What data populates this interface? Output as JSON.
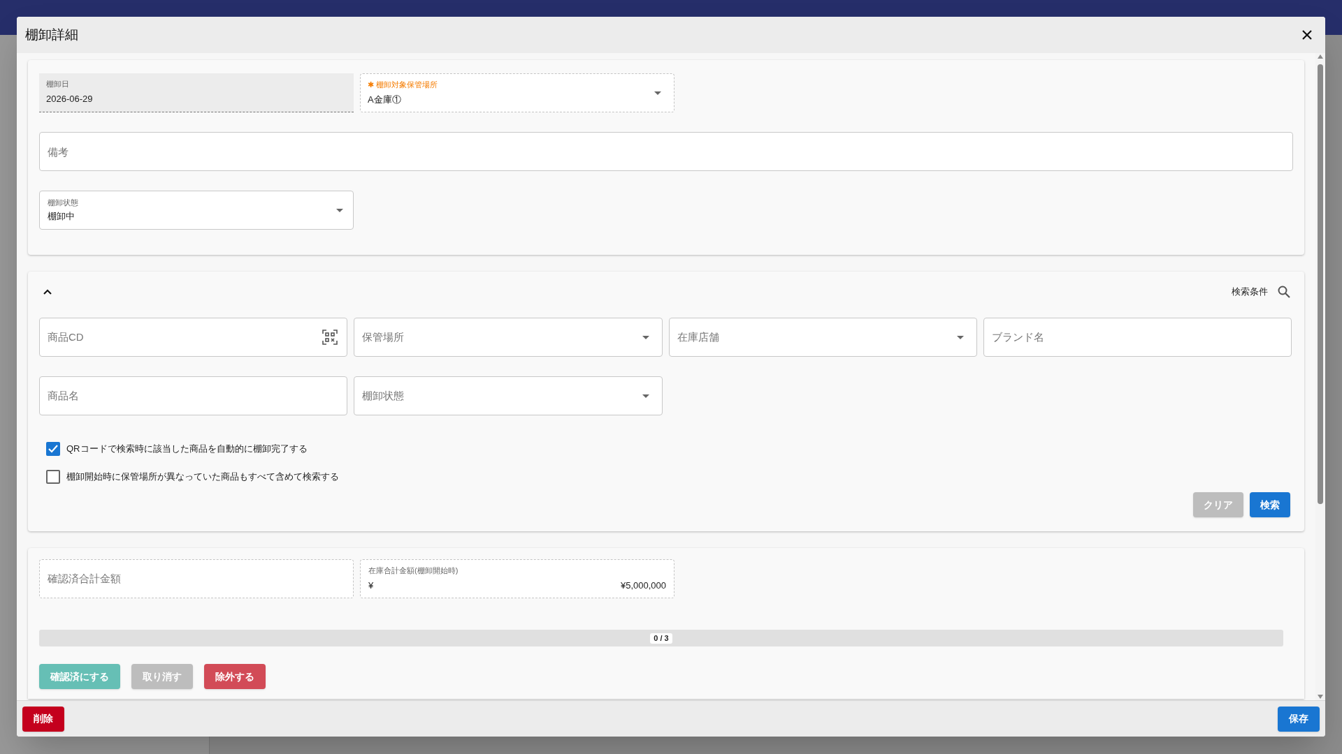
{
  "dialog": {
    "title": "棚卸詳細"
  },
  "details": {
    "fields": [
      {
        "kind": "readonly",
        "label": "棚卸日",
        "value": "2026-06-29",
        "required": false
      },
      {
        "kind": "select",
        "label": "棚卸対象保管場所",
        "value": "A金庫①",
        "required": true,
        "marker": "✱"
      }
    ],
    "remarks": {
      "placeholder": "備考"
    },
    "status": {
      "label": "棚卸状態",
      "value": "棚卸中"
    }
  },
  "search": {
    "expanded": true,
    "title": "検索条件",
    "fields": [
      {
        "kind": "scan",
        "placeholder": "商品CD"
      },
      {
        "kind": "select",
        "placeholder": "保管場所"
      },
      {
        "kind": "select",
        "placeholder": "在庫店舗"
      },
      {
        "kind": "text",
        "placeholder": "ブランド名"
      },
      {
        "kind": "text",
        "placeholder": "商品名"
      },
      {
        "kind": "select",
        "placeholder": "棚卸状態"
      }
    ],
    "options": [
      {
        "label": "QRコードで検索時に該当した商品を自動的に棚卸完了する",
        "checked": true
      },
      {
        "label": "棚卸開始時に保管場所が異なっていた商品もすべて含めて検索する",
        "checked": false
      }
    ],
    "buttons": [
      {
        "label": "クリア",
        "kind": "secondary"
      },
      {
        "label": "検索",
        "kind": "primary"
      }
    ]
  },
  "totals": {
    "fields": [
      {
        "kind": "empty",
        "placeholder": "確認済合計金額"
      },
      {
        "kind": "amount",
        "label": "在庫合計金額(棚卸開始時)",
        "prefix": "¥",
        "value": "¥5,000,000"
      }
    ],
    "progress": {
      "level": 0,
      "reading": "0 / 3"
    },
    "actions": [
      {
        "label": "確認済にする",
        "kind": "confirm"
      },
      {
        "label": "取り消す",
        "kind": "cancel"
      },
      {
        "label": "除外する",
        "kind": "exclude"
      }
    ]
  },
  "footer": {
    "buttons": [
      {
        "label": "削除",
        "kind": "danger"
      },
      {
        "label": "保存",
        "kind": "primary"
      }
    ]
  }
}
